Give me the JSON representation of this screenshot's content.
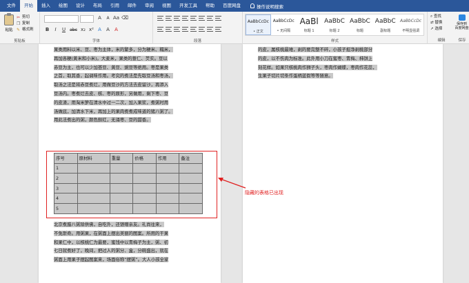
{
  "tabs": [
    "文件",
    "开始",
    "插入",
    "绘图",
    "设计",
    "布局",
    "引用",
    "邮件",
    "审阅",
    "视图",
    "开发工具",
    "帮助",
    "百度网盘"
  ],
  "active_tab": "开始",
  "tell_me": "操作说明搜索",
  "clipboard": {
    "paste": "粘贴",
    "cut": "剪切",
    "copy": "复制",
    "format_painter": "格式刷",
    "label": "剪贴板"
  },
  "font_group": {
    "label": "字体",
    "buttons": [
      "B",
      "I",
      "U",
      "abc",
      "x₂",
      "x²",
      "A",
      "A",
      "A"
    ]
  },
  "paragraph_label": "段落",
  "styles": {
    "label": "样式",
    "items": [
      {
        "preview": "AaBbCcDc",
        "name": "• 正文",
        "size": "small"
      },
      {
        "preview": "AaBbCcDc",
        "name": "• 无间隔",
        "size": "small"
      },
      {
        "preview": "AaBl",
        "name": "标题 1",
        "size": "big"
      },
      {
        "preview": "AaBbC",
        "name": "标题 2",
        "size": "mid"
      },
      {
        "preview": "AaBbC",
        "name": "标题",
        "size": "mid"
      },
      {
        "preview": "AaBbC",
        "name": "副标题",
        "size": "mid"
      },
      {
        "preview": "AaBbCcDc",
        "name": "不明显强调",
        "size": "small"
      }
    ]
  },
  "editing": {
    "label": "编辑",
    "find": "查找",
    "replace": "替换",
    "select": "选择"
  },
  "save_group": {
    "line1": "保存到",
    "line2": "百度网盘",
    "label": "保存"
  },
  "page1_lines_top": [
    "果类用料以米、豆、枣为主体，米的繁多，分为粳米、糯米，",
    "再加各粳(黄米和小米)。大麦米，果类的薏仁、芡实。豆以",
    "赤豆为主，也可以少加荟豆、黄豆、豌豆等绝用。枣是果类",
    "之首，取其香，起调味作用。考究的煮法是先取豆汤和枣汤，",
    "取汤之法是将赤豆煮烂，用做豆沙的方法去皮留沙，再添入",
    "豆汤内。枣煮烂去皮、核、枣的原形，另做用，剩下枣、豆",
    "的皮渣，用淘米箩在清水中过一二次，加入果浆，煮粥时用",
    "汤做底，加清水下米，再加上的果肉煮煮成味道的猪八粥了。",
    "用此法煮出的粥，颜色鲜红，无涌枣、豆的甜香。"
  ],
  "table": {
    "headers": [
      "序号",
      "原材料",
      "重量",
      "价格",
      "作用",
      "备注"
    ],
    "rows": [
      [
        "1",
        "",
        "",
        "",
        "",
        ""
      ],
      [
        "2",
        "",
        "",
        "",
        "",
        ""
      ],
      [
        "3",
        "",
        "",
        "",
        "",
        ""
      ],
      [
        "4",
        "",
        "",
        "",
        "",
        ""
      ],
      [
        "5",
        "",
        "",
        "",
        "",
        ""
      ]
    ]
  },
  "page1_lines_bottom": [
    "北京煮腊八粥除供佛，自吃外，还馈赠亲友。礼尚往来，",
    "不免斯奇。用粥果，在粥面上摆出美丽的图案。所用的干果",
    "和果仁中，以核桃仁为最要，蜜饯中以青梅子为主，粥、初",
    "七日就煮好了，晚间，把过人的粥分、盒，分碗盛出，就在",
    "粥面上用果子摆起图案来，场面俗称“摆粥”。大人小孩全家"
  ],
  "page2_lines": [
    "的皮，属核桃最难，剥的要完整不碎，小孩子担净剥桃部分",
    "的皮，以不伤肉为标准。此外用小刀在蜜枣、青梅、柿饼上",
    "刻花样。如果只核桃肉作狮子头，枣肉作蝴蝶，枣肉作花蕊，",
    "生果子切片切条作蛋柄蓝假等等随意。"
  ],
  "annotation": "隐藏的表格已出现",
  "colors": {
    "ribbon_blue": "#2b579a",
    "annotation_red": "#e02020",
    "shade": "#c8c8c8"
  }
}
